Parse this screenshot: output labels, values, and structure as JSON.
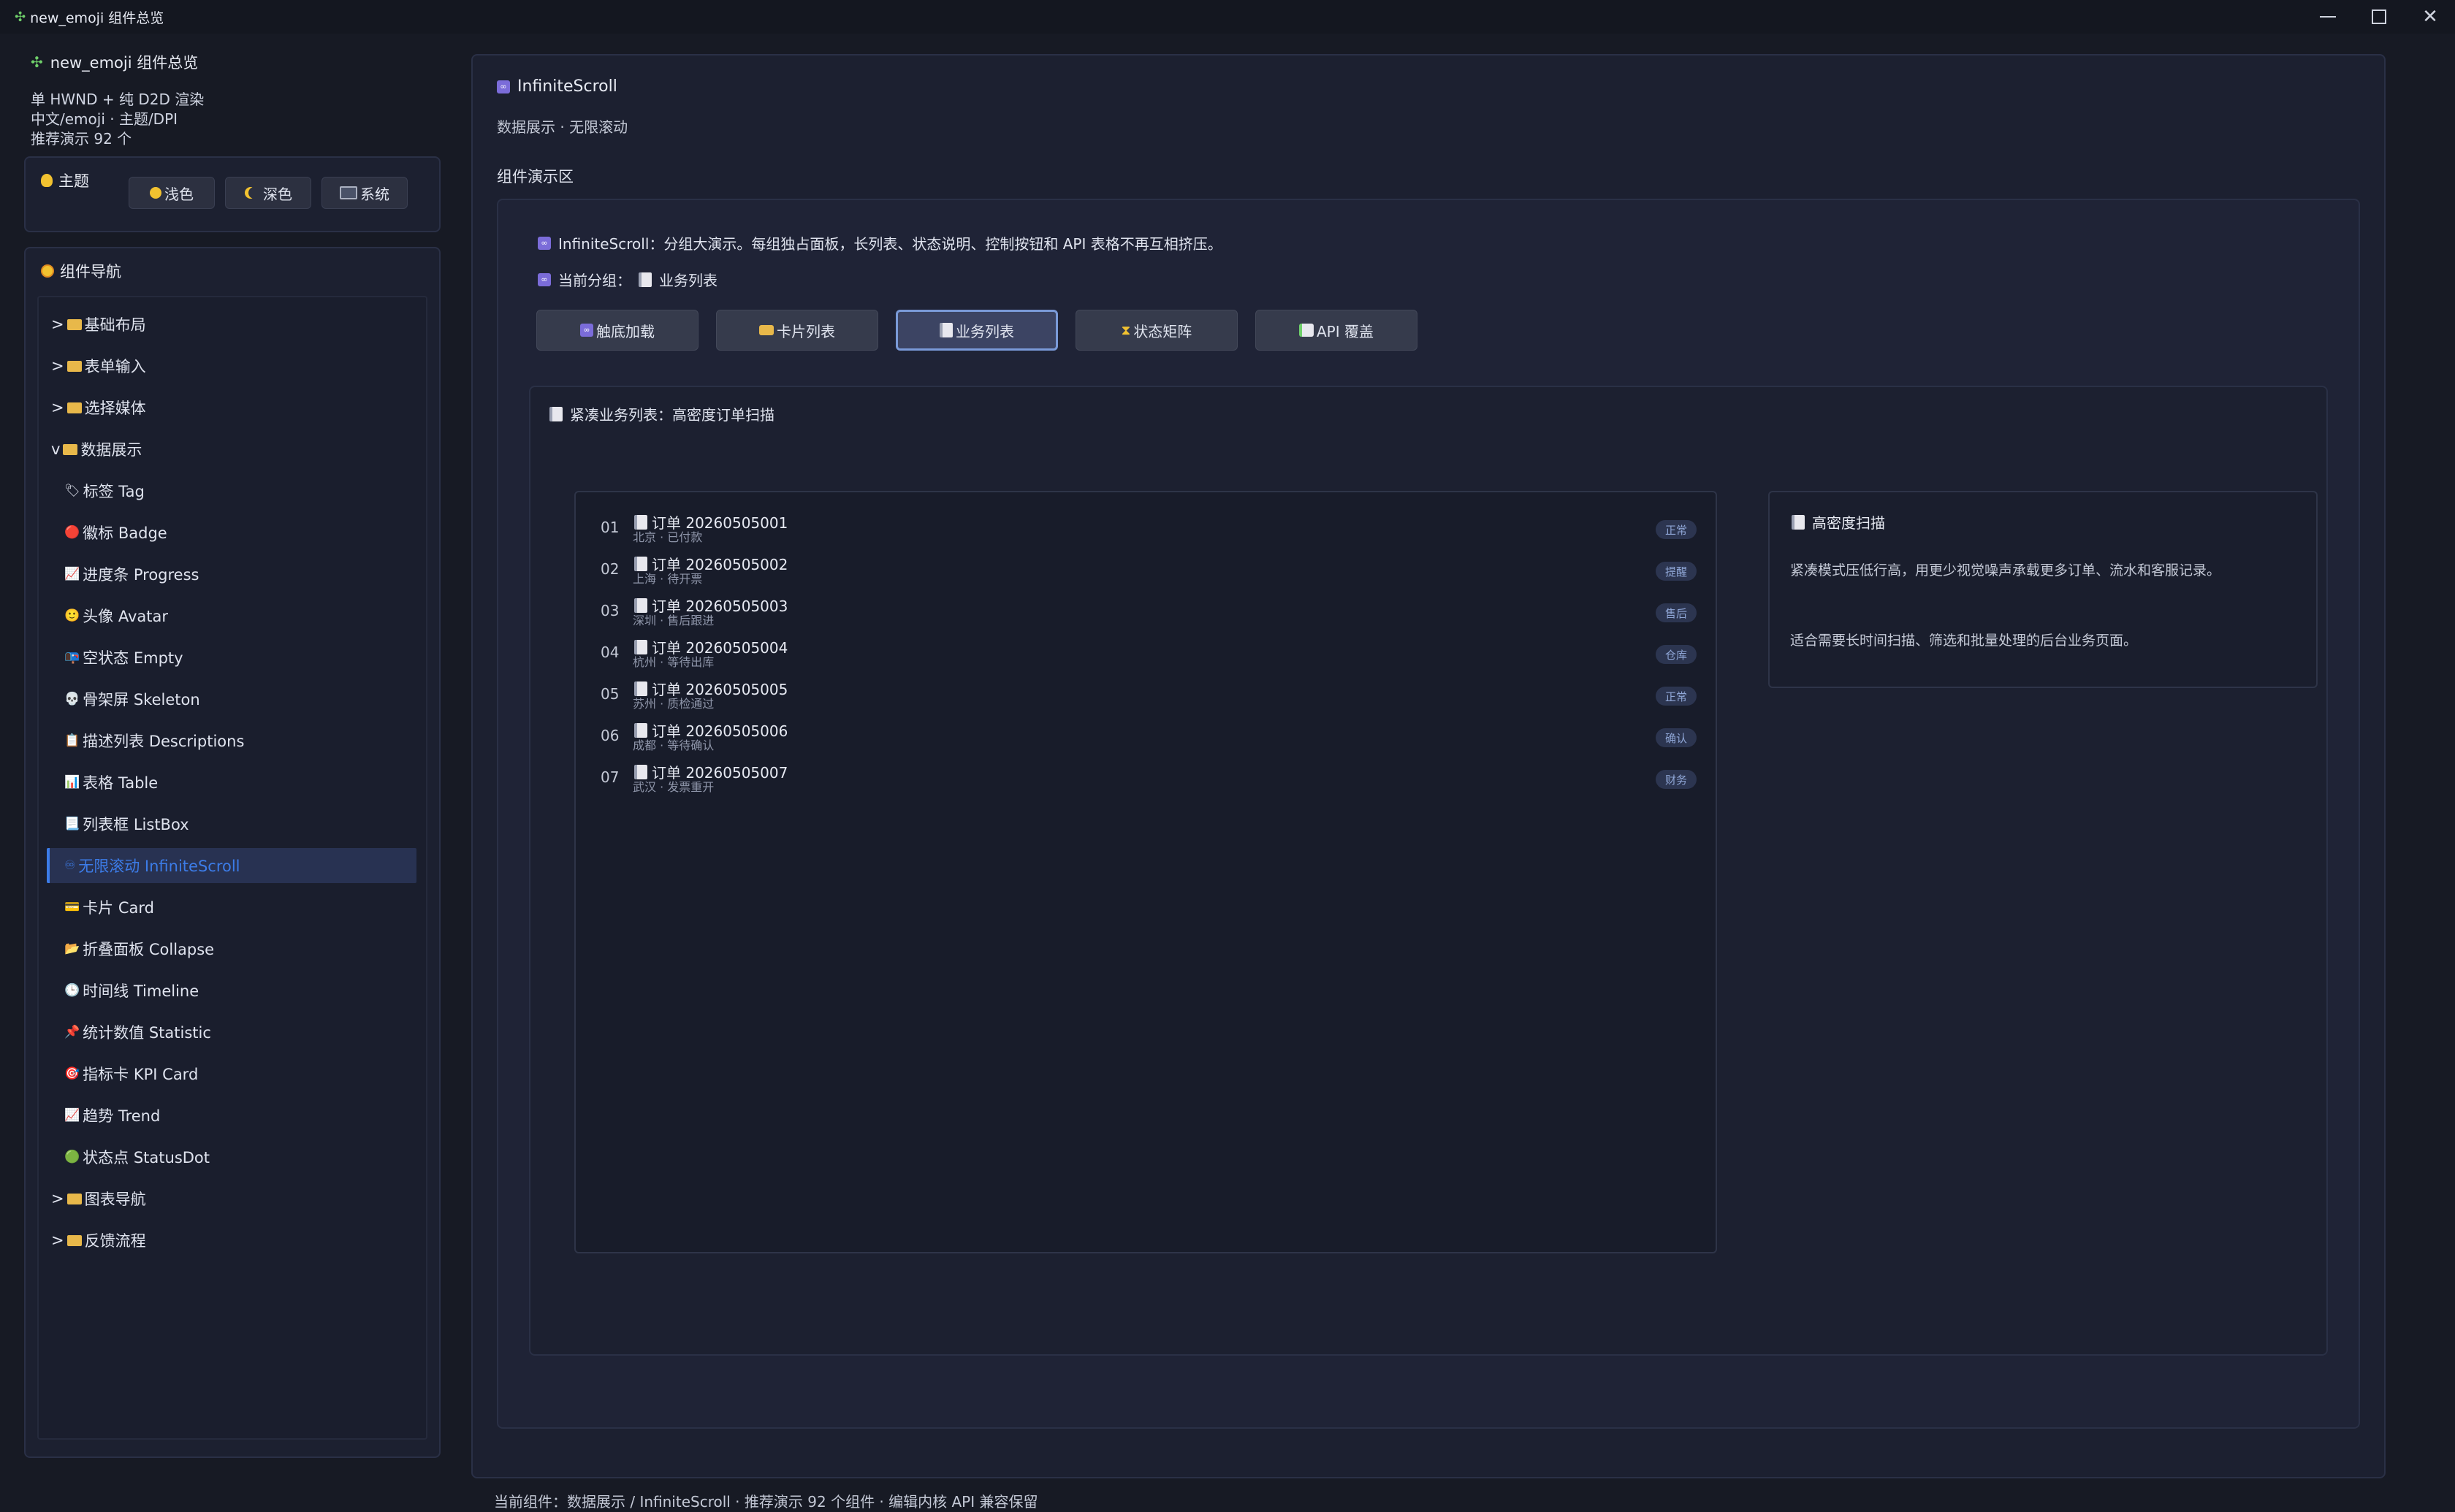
{
  "window": {
    "title": "new_emoji 组件总览",
    "minimize_glyph": "—",
    "maximize_glyph": "☐",
    "close_glyph": "✕"
  },
  "sidebar": {
    "app_title": "new_emoji 组件总览",
    "info": [
      "单 HWND + 纯 D2D 渲染",
      "中文/emoji · 主题/DPI",
      "推荐演示 92 个"
    ],
    "theme": {
      "label": "主题",
      "buttons": [
        "浅色",
        "深色",
        "系统"
      ]
    },
    "nav": {
      "label": "组件导航",
      "items": [
        {
          "prefix": ">",
          "label": "基础布局",
          "level": 0
        },
        {
          "prefix": ">",
          "label": "表单输入",
          "level": 0
        },
        {
          "prefix": ">",
          "label": "选择媒体",
          "level": 0
        },
        {
          "prefix": "v",
          "label": "数据展示",
          "level": 0
        },
        {
          "icon": "tag-icon",
          "glyph": "🏷",
          "label": "标签 Tag",
          "level": 1
        },
        {
          "icon": "red-dot-icon",
          "glyph": "🔴",
          "label": "徽标 Badge",
          "level": 1
        },
        {
          "icon": "chart-up-icon",
          "glyph": "📈",
          "label": "进度条 Progress",
          "level": 1
        },
        {
          "icon": "face-icon",
          "glyph": "🙂",
          "label": "头像 Avatar",
          "level": 1
        },
        {
          "icon": "empty-icon",
          "glyph": "📭",
          "label": "空状态 Empty",
          "level": 1
        },
        {
          "icon": "skull-icon",
          "glyph": "💀",
          "label": "骨架屏 Skeleton",
          "level": 1
        },
        {
          "icon": "clipboard-icon",
          "glyph": "📋",
          "label": "描述列表 Descriptions",
          "level": 1
        },
        {
          "icon": "bar-chart-icon",
          "glyph": "📊",
          "label": "表格 Table",
          "level": 1
        },
        {
          "icon": "list-icon",
          "glyph": "📃",
          "label": "列表框 ListBox",
          "level": 1
        },
        {
          "icon": "infinity-icon",
          "glyph": "♾",
          "label": "无限滚动 InfiniteScroll",
          "level": 1,
          "selected": true
        },
        {
          "icon": "card-icon",
          "glyph": "💳",
          "label": "卡片 Card",
          "level": 1
        },
        {
          "icon": "folder-icon",
          "glyph": "📂",
          "label": "折叠面板 Collapse",
          "level": 1
        },
        {
          "icon": "clock-icon",
          "glyph": "🕒",
          "label": "时间线 Timeline",
          "level": 1
        },
        {
          "icon": "pin-icon",
          "glyph": "📌",
          "label": "统计数值 Statistic",
          "level": 1
        },
        {
          "icon": "target-icon",
          "glyph": "🎯",
          "label": "指标卡 KPI Card",
          "level": 1
        },
        {
          "icon": "trend-icon",
          "glyph": "📈",
          "label": "趋势 Trend",
          "level": 1
        },
        {
          "icon": "green-dot-icon",
          "glyph": "🟢",
          "label": "状态点 StatusDot",
          "level": 1
        },
        {
          "prefix": ">",
          "label": "图表导航",
          "level": 0
        },
        {
          "prefix": ">",
          "label": "反馈流程",
          "level": 0
        }
      ]
    }
  },
  "main": {
    "component_title": "InfiniteScroll",
    "breadcrumb": "数据展示 · 无限滚动",
    "demo_area_label": "组件演示区",
    "desc_line": "InfiniteScroll：分组大演示。每组独占面板，长列表、状态说明、控制按钮和 API 表格不再互相挤压。",
    "current_group_label": "当前分组：",
    "current_group_value": "业务列表",
    "tabs": [
      {
        "label": "触底加载",
        "icon": "infinity-icon",
        "glyph": "♾"
      },
      {
        "label": "卡片列表",
        "icon": "card-icon",
        "glyph": "💳"
      },
      {
        "label": "业务列表",
        "icon": "document-icon",
        "glyph": "📄",
        "active": true
      },
      {
        "label": "状态矩阵",
        "icon": "hourglass-icon",
        "glyph": "⏳"
      },
      {
        "label": "API 覆盖",
        "icon": "memo-icon",
        "glyph": "📝"
      }
    ],
    "panel_title": "紧凑业务列表：高密度订单扫描",
    "list": [
      {
        "idx": "01",
        "title": "订单 20260505001",
        "sub": "北京 · 已付款",
        "badge": "正常"
      },
      {
        "idx": "02",
        "title": "订单 20260505002",
        "sub": "上海 · 待开票",
        "badge": "提醒"
      },
      {
        "idx": "03",
        "title": "订单 20260505003",
        "sub": "深圳 · 售后跟进",
        "badge": "售后"
      },
      {
        "idx": "04",
        "title": "订单 20260505004",
        "sub": "杭州 · 等待出库",
        "badge": "仓库"
      },
      {
        "idx": "05",
        "title": "订单 20260505005",
        "sub": "苏州 · 质检通过",
        "badge": "正常"
      },
      {
        "idx": "06",
        "title": "订单 20260505006",
        "sub": "成都 · 等待确认",
        "badge": "确认"
      },
      {
        "idx": "07",
        "title": "订单 20260505007",
        "sub": "武汉 · 发票重开",
        "badge": "财务"
      }
    ],
    "info_card": {
      "title": "高密度扫描",
      "line1": "紧凑模式压低行高，用更少视觉噪声承载更多订单、流水和客服记录。",
      "line2": "适合需要长时间扫描、筛选和批量处理的后台业务页面。"
    }
  },
  "status_bar": "当前组件：数据展示 / InfiniteScroll · 推荐演示 92 个组件 · 编辑内核 API 兼容保留",
  "colors": {
    "background": "#171a24",
    "panel": "#1c2030",
    "accent": "#3c7ce8",
    "badge_text": "#8fa6d6"
  }
}
